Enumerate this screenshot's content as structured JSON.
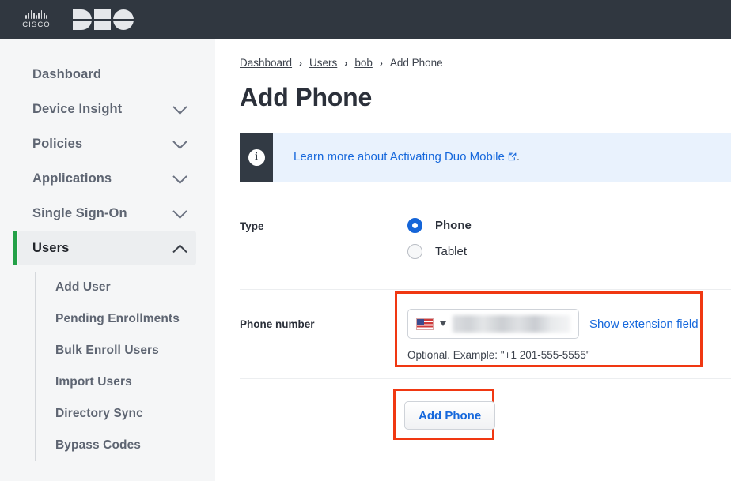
{
  "topbar": {
    "cisco_wordmark": "CISCO",
    "product_logo": "DUO"
  },
  "sidebar": {
    "items": [
      {
        "label": "Dashboard",
        "expandable": false,
        "active": false
      },
      {
        "label": "Device Insight",
        "expandable": true,
        "active": false
      },
      {
        "label": "Policies",
        "expandable": true,
        "active": false
      },
      {
        "label": "Applications",
        "expandable": true,
        "active": false
      },
      {
        "label": "Single Sign-On",
        "expandable": true,
        "active": false
      },
      {
        "label": "Users",
        "expandable": true,
        "active": true
      }
    ],
    "subitems": [
      {
        "label": "Add User"
      },
      {
        "label": "Pending Enrollments"
      },
      {
        "label": "Bulk Enroll Users"
      },
      {
        "label": "Import Users"
      },
      {
        "label": "Directory Sync"
      },
      {
        "label": "Bypass Codes"
      }
    ]
  },
  "breadcrumb": {
    "items": [
      {
        "label": "Dashboard",
        "link": true
      },
      {
        "label": "Users",
        "link": true
      },
      {
        "label": "bob",
        "link": true
      },
      {
        "label": "Add Phone",
        "link": false
      }
    ],
    "separator": "›"
  },
  "page": {
    "title": "Add Phone"
  },
  "banner": {
    "icon": "info-icon",
    "link_text": "Learn more about Activating Duo Mobile",
    "external_icon": "external-link-icon",
    "trailing_text": ".",
    "background_color": "#e9f2fd",
    "icon_block_color": "#323a44",
    "link_color": "#1668dc"
  },
  "form": {
    "type_field": {
      "label": "Type",
      "options": [
        {
          "label": "Phone",
          "selected": true
        },
        {
          "label": "Tablet",
          "selected": false
        }
      ],
      "selected_color": "#1565d8"
    },
    "phone_field": {
      "label": "Phone number",
      "country_flag": "us-flag-icon",
      "country_caret": "caret-down-icon",
      "value": "",
      "value_redacted": true,
      "extension_link": "Show extension field",
      "helper_text": "Optional. Example: \"+1 201-555-5555\"",
      "highlight_color": "#f03812"
    },
    "submit": {
      "label": "Add Phone",
      "text_color": "#1668dc",
      "highlight_color": "#f03812"
    }
  }
}
